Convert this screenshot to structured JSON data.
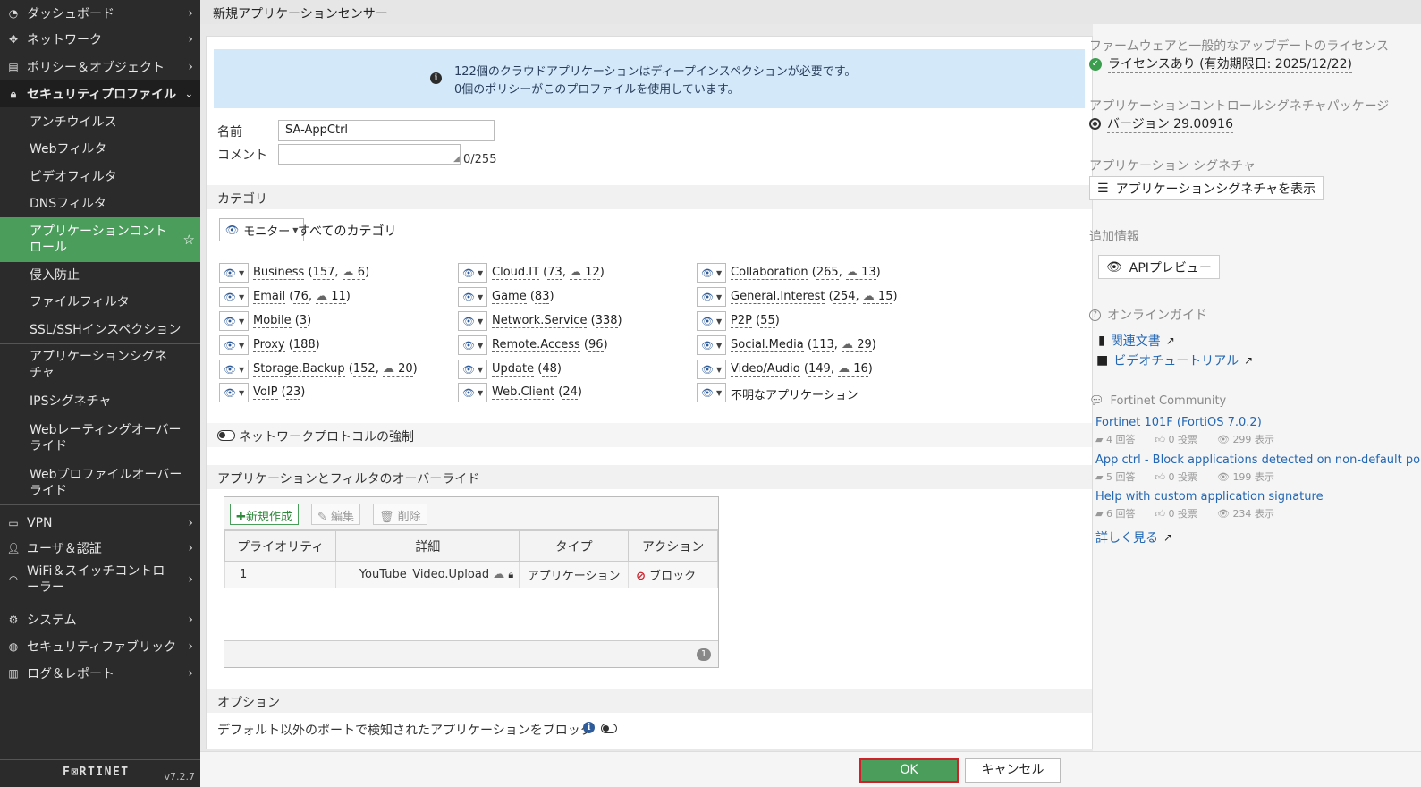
{
  "sidebar": {
    "items": [
      {
        "icon": "dashboard-icon",
        "label": "ダッシュボード"
      },
      {
        "icon": "network-icon",
        "label": "ネットワーク"
      },
      {
        "icon": "policy-icon",
        "label": "ポリシー＆オブジェクト"
      },
      {
        "icon": "lock-icon",
        "label": "セキュリティプロファイル"
      }
    ],
    "subitems": [
      "アンチウイルス",
      "Webフィルタ",
      "ビデオフィルタ",
      "DNSフィルタ",
      "アプリケーションコントロール",
      "侵入防止",
      "ファイルフィルタ",
      "SSL/SSHインスペクション",
      "アプリケーションシグネチャ",
      "IPSシグネチャ",
      "Webレーティングオーバーライド",
      "Webプロファイルオーバーライド"
    ],
    "bottom_items": [
      {
        "icon": "laptop-icon",
        "label": "VPN"
      },
      {
        "icon": "user-icon",
        "label": "ユーザ＆認証"
      },
      {
        "icon": "wifi-icon",
        "label": "WiFi＆スイッチコントローラー"
      },
      {
        "icon": "gear-icon",
        "label": "システム"
      },
      {
        "icon": "fabric-icon",
        "label": "セキュリティファブリック"
      },
      {
        "icon": "chart-icon",
        "label": "ログ＆レポート"
      }
    ],
    "brand": "F⊠RTINET",
    "version": "v7.2.7"
  },
  "page": {
    "title": "新規アプリケーションセンサー"
  },
  "banner": {
    "line1": "122個のクラウドアプリケーションはディープインスペクションが必要です。",
    "line2": "0個のポリシーがこのプロファイルを使用しています。"
  },
  "form": {
    "name_label": "名前",
    "name_value": "SA-AppCtrl",
    "comment_label": "コメント",
    "comment_value": "",
    "comment_counter": "0/255"
  },
  "categories": {
    "section_title": "カテゴリ",
    "monitor_label": "モニター",
    "all_label": "すべてのカテゴリ",
    "items": [
      {
        "name": "Business",
        "count": "157",
        "cloud": "6"
      },
      {
        "name": "Cloud.IT",
        "count": "73",
        "cloud": "12"
      },
      {
        "name": "Collaboration",
        "count": "265",
        "cloud": "13"
      },
      {
        "name": "Email",
        "count": "76",
        "cloud": "11"
      },
      {
        "name": "Game",
        "count": "83",
        "cloud": ""
      },
      {
        "name": "General.Interest",
        "count": "254",
        "cloud": "15"
      },
      {
        "name": "Mobile",
        "count": "3",
        "cloud": ""
      },
      {
        "name": "Network.Service",
        "count": "338",
        "cloud": ""
      },
      {
        "name": "P2P",
        "count": "55",
        "cloud": ""
      },
      {
        "name": "Proxy",
        "count": "188",
        "cloud": ""
      },
      {
        "name": "Remote.Access",
        "count": "96",
        "cloud": ""
      },
      {
        "name": "Social.Media",
        "count": "113",
        "cloud": "29"
      },
      {
        "name": "Storage.Backup",
        "count": "152",
        "cloud": "20"
      },
      {
        "name": "Update",
        "count": "48",
        "cloud": ""
      },
      {
        "name": "Video/Audio",
        "count": "149",
        "cloud": "16"
      },
      {
        "name": "VoIP",
        "count": "23",
        "cloud": ""
      },
      {
        "name": "Web.Client",
        "count": "24",
        "cloud": ""
      },
      {
        "name": "不明なアプリケーション",
        "count": "",
        "cloud": ""
      }
    ]
  },
  "protocol": {
    "label": "ネットワークプロトコルの強制"
  },
  "overrides": {
    "section_title": "アプリケーションとフィルタのオーバーライド",
    "create_label": "新規作成",
    "edit_label": "編集",
    "delete_label": "削除",
    "columns": [
      "プライオリティ",
      "詳細",
      "タイプ",
      "アクション"
    ],
    "rows": [
      {
        "priority": "1",
        "detail": "YouTube_Video.Upload",
        "type": "アプリケーション",
        "action": "ブロック"
      }
    ],
    "page_count": "1"
  },
  "options": {
    "section_title": "オプション",
    "block_nondefault_label": "デフォルト以外のポートで検知されたアプリケーションをブロック"
  },
  "right_panel": {
    "license_head": "ファームウェアと一般的なアップデートのライセンス",
    "license_status": "ライセンスあり (有効期限日: 2025/12/22)",
    "pkg_head": "アプリケーションコントロールシグネチャパッケージ",
    "pkg_version": "バージョン 29.00916",
    "sig_head": "アプリケーション シグネチャ",
    "sig_button": "アプリケーションシグネチャを表示",
    "extra_head": "追加情報",
    "api_button": "APIプレビュー",
    "guide_head": "オンラインガイド",
    "guide_links": [
      "関連文書",
      "ビデオチュートリアル"
    ],
    "community_head": "Fortinet Community",
    "posts": [
      {
        "title": "Fortinet 101F (FortiOS 7.0.2)",
        "replies": "4 回答",
        "votes": "0 投票",
        "views": "299 表示"
      },
      {
        "title": "App ctrl - Block applications detected on non-default ports",
        "replies": "5 回答",
        "votes": "0 投票",
        "views": "199 表示"
      },
      {
        "title": "Help with custom application signature",
        "replies": "6 回答",
        "votes": "0 投票",
        "views": "234 表示"
      }
    ],
    "more_link": "詳しく見る"
  },
  "footer": {
    "ok_label": "OK",
    "cancel_label": "キャンセル"
  }
}
